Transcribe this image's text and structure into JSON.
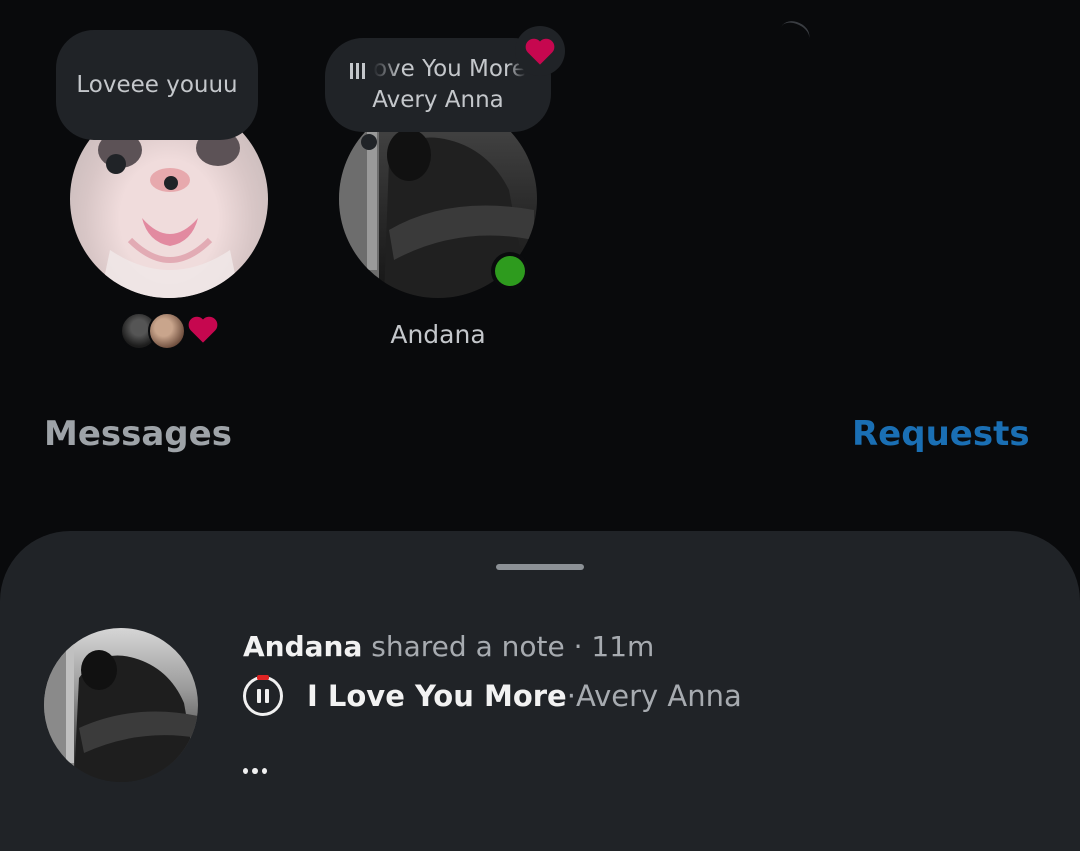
{
  "notes": [
    {
      "text": "Loveee youuu"
    },
    {
      "song_fragment": "ove You More",
      "artist": "Avery Anna"
    }
  ],
  "contacts": [
    {
      "name": "Andana",
      "online": true
    }
  ],
  "section": {
    "messages_label": "Messages",
    "requests_label": "Requests"
  },
  "sheet": {
    "author": "Andana",
    "action": " shared a note · 11m",
    "song_title": "I Love You More",
    "separator": " · ",
    "artist": "Avery Anna",
    "more_label": "..."
  },
  "colors": {
    "background": "#090a0c",
    "bubble": "#202327",
    "accent_link": "#1a6fb4",
    "heart": "#c6074f",
    "online": "#2e9b1e"
  }
}
